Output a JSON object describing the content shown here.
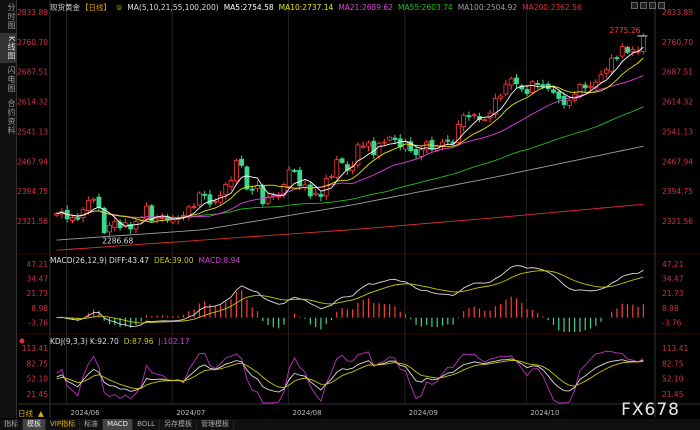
{
  "sidebar": {
    "items": [
      {
        "label": "分时图",
        "active": false
      },
      {
        "label": "K线图",
        "active": true
      },
      {
        "label": "闪电图",
        "active": false
      },
      {
        "label": "合约资料",
        "active": false
      }
    ]
  },
  "header": {
    "symbol": "现货黄金",
    "period": "【日线】",
    "ma_params": "MA(5,10,21,55,100,200)",
    "ma5": "MA5:2754.58",
    "ma10": "MA10:2737.14",
    "ma21": "MA21:2689.62",
    "ma55": "MA55:2603.74",
    "ma100": "MA100:2504.92",
    "ma200": "MA200:2362.56"
  },
  "macd_header": {
    "params": "MACD(26,12,9)",
    "diff": "DIFF:43.47",
    "dea": "DEA:39.00",
    "macd": "MACD:8.94"
  },
  "kdj_header": {
    "params": "KDJ(9,3,3)",
    "k": "K:92.70",
    "d": "D:87.96",
    "j": "J:102.17"
  },
  "annotations": {
    "high": "2775.26",
    "low": "2286.68"
  },
  "axis": {
    "price_ticks": [
      "2833.89",
      "2760.70",
      "2687.51",
      "2614.32",
      "2541.13",
      "2467.94",
      "2394.75",
      "2321.56"
    ],
    "macd_ticks": [
      "47.21",
      "34.47",
      "21.73",
      "8.98",
      "-3.76"
    ],
    "kdj_ticks": [
      "113.41",
      "82.75",
      "52.10",
      "21.45"
    ],
    "dates": [
      "2024/06",
      "2024/07",
      "2024/08",
      "2024/09",
      "2024/10"
    ],
    "period_label": "日线"
  },
  "tabs": [
    {
      "label": "指标",
      "selected": false
    },
    {
      "label": "模板",
      "selected": true
    },
    {
      "label": "VIP指标",
      "selected": false,
      "vip": true
    },
    {
      "label": "标准",
      "selected": false
    },
    {
      "label": "MACD",
      "selected": true
    },
    {
      "label": "BOLL",
      "selected": false
    },
    {
      "label": "另存模板",
      "selected": false
    },
    {
      "label": "管理模板",
      "selected": false
    }
  ],
  "watermark": "FX678",
  "colors": {
    "up": "#ff3b3b",
    "down": "#3dd68c",
    "ma5": "#ffffff",
    "ma10": "#e8e800",
    "ma21": "#e040e0",
    "ma55": "#20c020",
    "ma100": "#a0a0a0",
    "ma200": "#e03030",
    "axis": "#d0304a"
  },
  "chart_data": {
    "type": "candlestick",
    "price_range": [
      2280,
      2833.89
    ],
    "closes": [
      2340,
      2345,
      2327,
      2330,
      2326,
      2350,
      2372,
      2375,
      2355,
      2293,
      2311,
      2320,
      2305,
      2317,
      2302,
      2320,
      2330,
      2358,
      2322,
      2330,
      2330,
      2324,
      2326,
      2330,
      2335,
      2356,
      2357,
      2390,
      2385,
      2363,
      2370,
      2384,
      2411,
      2421,
      2470,
      2458,
      2400,
      2397,
      2409,
      2364,
      2380,
      2385,
      2383,
      2411,
      2447,
      2443,
      2408,
      2410,
      2383,
      2390,
      2382,
      2426,
      2431,
      2472,
      2465,
      2446,
      2456,
      2508,
      2505,
      2513,
      2484,
      2512,
      2515,
      2527,
      2521,
      2503,
      2517,
      2494,
      2484,
      2496,
      2515,
      2498,
      2505,
      2515,
      2517,
      2512,
      2558,
      2581,
      2577,
      2582,
      2570,
      2570,
      2586,
      2622,
      2628,
      2657,
      2670,
      2658,
      2645,
      2634,
      2663,
      2656,
      2653,
      2646,
      2637,
      2622,
      2607,
      2616,
      2631,
      2656,
      2648,
      2652,
      2662,
      2680,
      2692,
      2721,
      2721,
      2749,
      2735,
      2742,
      2738,
      2775
    ],
    "ma100_anchors": [
      2275,
      2300,
      2360,
      2430,
      2504.92
    ],
    "ma200_anchors": [
      2250,
      2275,
      2300,
      2330,
      2362.56
    ],
    "high": 2775.26,
    "low": 2286.68,
    "macd_range": [
      -12,
      50
    ],
    "kdj_range": [
      0,
      125
    ]
  }
}
